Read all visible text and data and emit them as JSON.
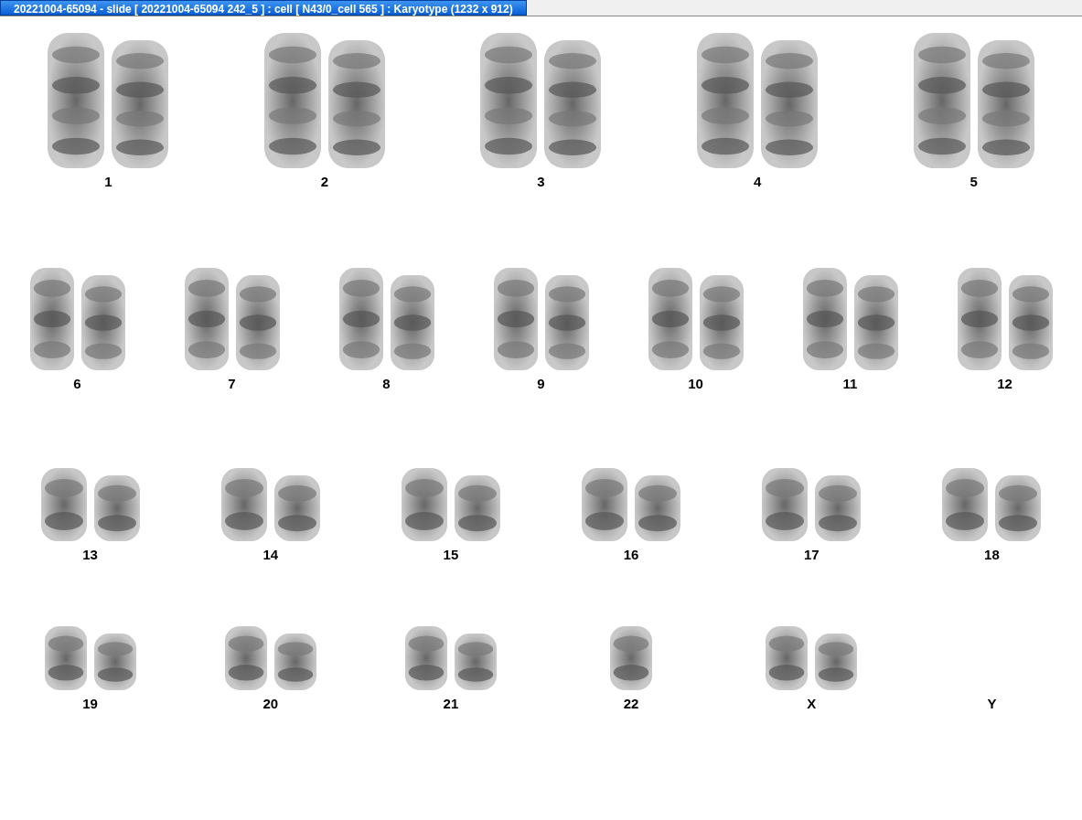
{
  "window": {
    "title": "20221004-65094 - slide [ 20221004-65094 242_5 ] : cell [ N43/0_cell 565 ] : Karyotype  (1232 x 912)"
  },
  "rows": [
    {
      "kind": "large",
      "pairs": [
        {
          "label": "1",
          "kind": "pair"
        },
        {
          "label": "2",
          "kind": "pair"
        },
        {
          "label": "3",
          "kind": "pair"
        },
        {
          "label": "4",
          "kind": "pair"
        },
        {
          "label": "5",
          "kind": "pair"
        }
      ]
    },
    {
      "kind": "medium",
      "pairs": [
        {
          "label": "6",
          "kind": "pair"
        },
        {
          "label": "7",
          "kind": "pair"
        },
        {
          "label": "8",
          "kind": "pair"
        },
        {
          "label": "9",
          "kind": "pair"
        },
        {
          "label": "10",
          "kind": "pair"
        },
        {
          "label": "11",
          "kind": "pair"
        },
        {
          "label": "12",
          "kind": "pair"
        }
      ]
    },
    {
      "kind": "small",
      "pairs": [
        {
          "label": "13",
          "kind": "pair"
        },
        {
          "label": "14",
          "kind": "pair"
        },
        {
          "label": "15",
          "kind": "pair"
        },
        {
          "label": "16",
          "kind": "pair"
        },
        {
          "label": "17",
          "kind": "pair"
        },
        {
          "label": "18",
          "kind": "pair"
        }
      ]
    },
    {
      "kind": "tiny",
      "pairs": [
        {
          "label": "19",
          "kind": "pair"
        },
        {
          "label": "20",
          "kind": "pair"
        },
        {
          "label": "21",
          "kind": "pair"
        },
        {
          "label": "22",
          "kind": "single"
        },
        {
          "label": "X",
          "kind": "pair"
        },
        {
          "label": "Y",
          "kind": "empty"
        }
      ]
    }
  ]
}
